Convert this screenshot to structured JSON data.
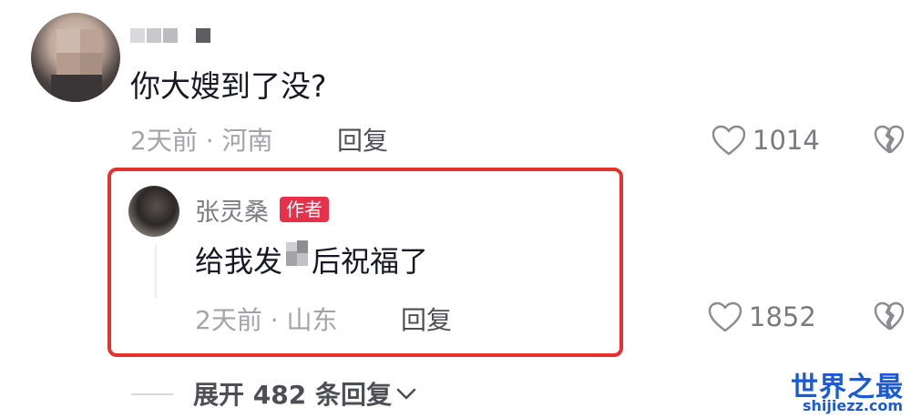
{
  "top_comment": {
    "text": "你大嫂到了没?",
    "time": "2天前 · 河南",
    "reply_label": "回复",
    "like_count": "1014"
  },
  "reply": {
    "author": "张灵桑",
    "author_badge": "作者",
    "text_before": "给我发",
    "text_after": "后祝福了",
    "time": "2天前 · 山东",
    "reply_label": "回复",
    "like_count": "1852"
  },
  "expand": {
    "label": "展开 482 条回复"
  },
  "watermark": {
    "title": "世界之最",
    "url": "shijiezz.com"
  },
  "colors": {
    "highlight_border": "#e5322d",
    "author_badge": "#e9304b",
    "watermark": "#1a5ad6"
  }
}
